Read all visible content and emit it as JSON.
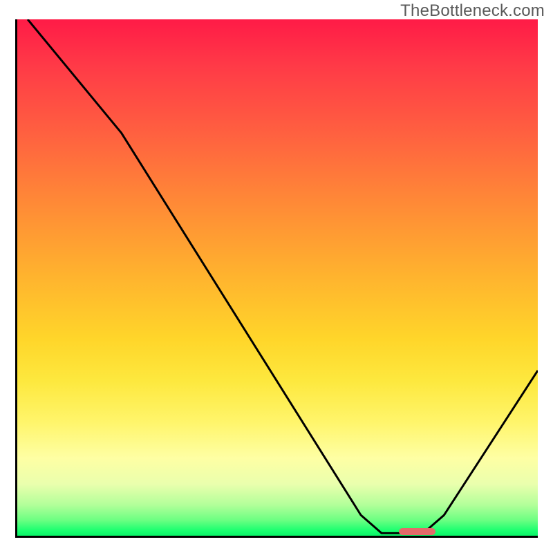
{
  "watermark": "TheBottleneck.com",
  "chart_data": {
    "type": "line",
    "title": "",
    "xlabel": "",
    "ylabel": "",
    "xlim": [
      0,
      100
    ],
    "ylim": [
      0,
      100
    ],
    "curve_points": [
      {
        "x": 2,
        "y": 100
      },
      {
        "x": 20,
        "y": 78
      },
      {
        "x": 66,
        "y": 4
      },
      {
        "x": 70,
        "y": 0.5
      },
      {
        "x": 78,
        "y": 0.5
      },
      {
        "x": 82,
        "y": 4
      },
      {
        "x": 100,
        "y": 32
      }
    ],
    "marker": {
      "x": 73,
      "width": 7,
      "y": 0.5,
      "height": 1.4,
      "color": "#e46a6a"
    },
    "gradient_stops": [
      {
        "pct": 0,
        "color": "#ff1b47"
      },
      {
        "pct": 50,
        "color": "#ffb42e"
      },
      {
        "pct": 78,
        "color": "#fff56b"
      },
      {
        "pct": 100,
        "color": "#09f568"
      }
    ],
    "axes": {
      "left": true,
      "bottom": true,
      "ticks": false,
      "labels": false
    }
  }
}
